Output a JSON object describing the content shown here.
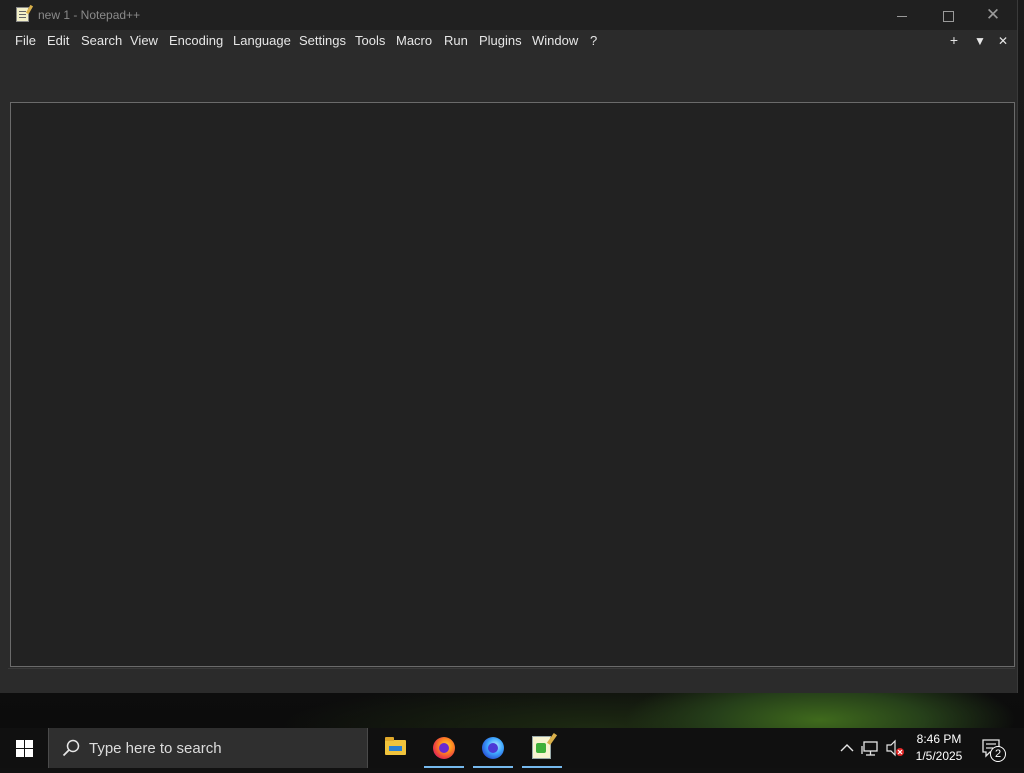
{
  "window": {
    "title": "new 1 - Notepad++",
    "controls": {
      "minimize": "minimize",
      "maximize": "maximize",
      "close": "close"
    }
  },
  "menubar": {
    "items": [
      "File",
      "Edit",
      "Search",
      "View",
      "Encoding",
      "Language",
      "Settings",
      "Tools",
      "Macro",
      "Run",
      "Plugins",
      "Window",
      "?"
    ],
    "right": {
      "add": "+",
      "list": "▼",
      "close": "✕"
    }
  },
  "editor": {
    "content": ""
  },
  "taskbar": {
    "search": {
      "placeholder": "Type here to search"
    },
    "apps": [
      {
        "name": "File Explorer",
        "icon": "folder-icon",
        "active": false
      },
      {
        "name": "Firefox",
        "icon": "firefox-icon",
        "active": true
      },
      {
        "name": "Firefox Developer Edition",
        "icon": "firefox-dev-icon",
        "active": true
      },
      {
        "name": "Notepad++",
        "icon": "notepad-plus-plus-icon",
        "active": true
      }
    ],
    "tray": {
      "time": "8:46 PM",
      "date": "1/5/2025",
      "notifications": "2"
    }
  },
  "colors": {
    "title_bg": "#202020",
    "window_bg": "#2b2b2b",
    "editor_bg": "#222222",
    "taskbar_bg": "#101010",
    "accent_underline": "#76b9ed"
  }
}
